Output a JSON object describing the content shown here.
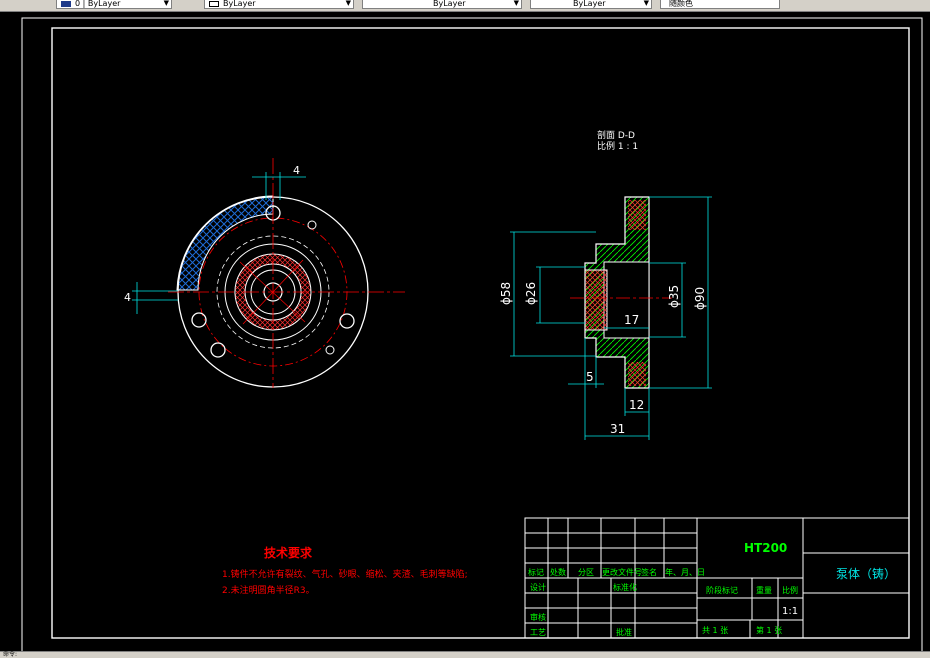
{
  "toolbar": {
    "layer_combo": "0 | ByLayer",
    "color_combo": "ByLayer",
    "linetype_combo": "ByLayer",
    "lineweight_combo": "ByLayer",
    "plotstyle_combo": "随颜色"
  },
  "drawing": {
    "section_title": "剖面 D-D",
    "section_scale": "比例 1 : 1",
    "dims": {
      "top_width": "4",
      "left_height": "4",
      "d58": "ϕ58",
      "d26": "ϕ26",
      "d35": "ϕ35",
      "d90": "ϕ90",
      "len17": "17",
      "len5": "5",
      "len12": "12",
      "len31": "31"
    },
    "tech_req": {
      "title": "技术要求",
      "line1": "1.铸件不允许有裂纹、气孔、砂眼、缩松、夹渣、毛刺等缺陷;",
      "line2": "2.未注明圆角半径R3。"
    },
    "title_block": {
      "material": "HT200",
      "part_name": "泵体（铸）",
      "h_mark": "标记",
      "h_count": "处数",
      "h_zone": "分区",
      "h_docno": "更改文件号",
      "h_sign": "签名",
      "h_date": "年、月、日",
      "h_design": "设计",
      "h_std": "标准化",
      "h_stage": "阶段标记",
      "h_weight": "重量",
      "h_scale": "比例",
      "scale_value": "1:1",
      "h_review": "审核",
      "h_process": "工艺",
      "h_approve": "批准",
      "total_sheets": "共 1 张",
      "sheet_no": "第 1 张"
    }
  },
  "status": {
    "text": "命令:"
  },
  "colors": {
    "white": "#ffffff",
    "cyan": "#00e5e5",
    "red": "#ff0000",
    "green": "#00ff00",
    "hatch": "#1e6bd6"
  }
}
